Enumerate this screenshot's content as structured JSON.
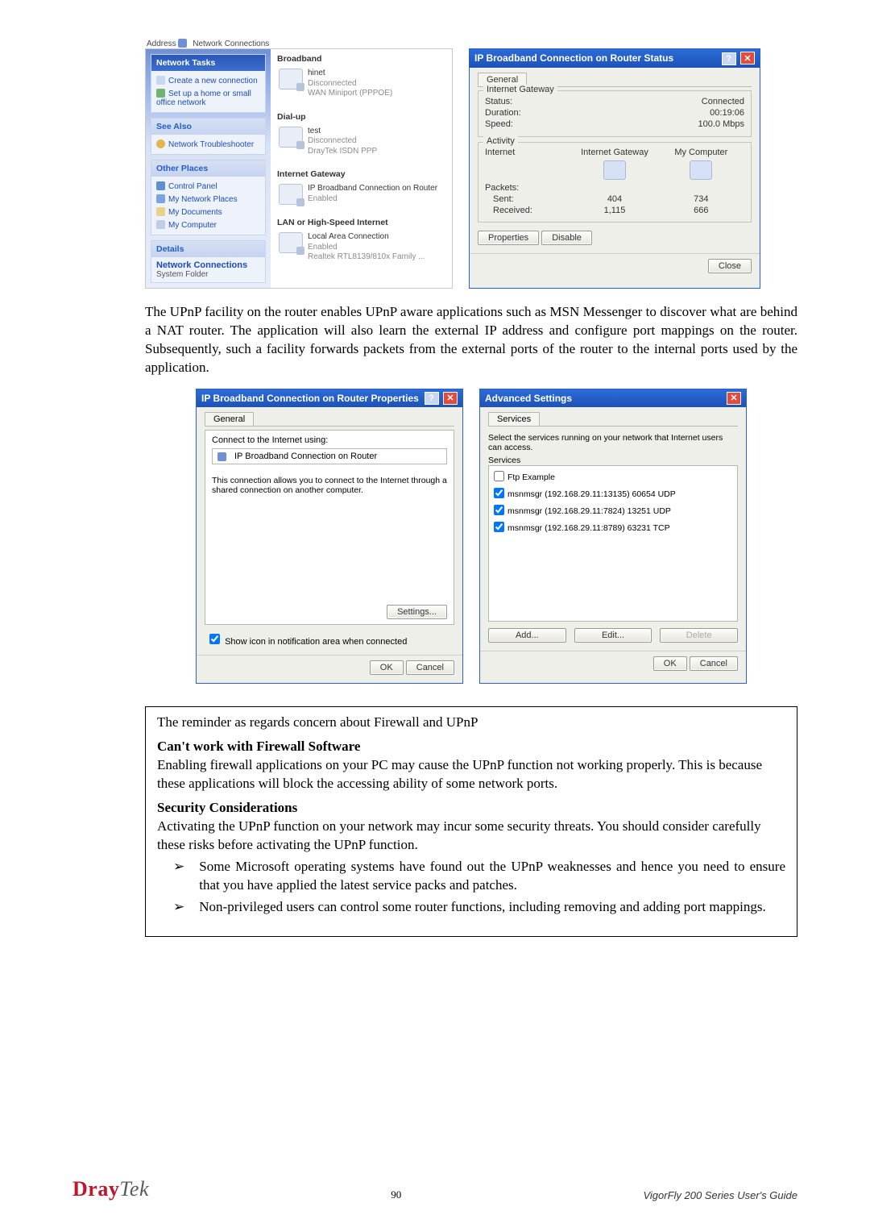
{
  "nc": {
    "addressLabel": "Address",
    "addressValue": "Network Connections",
    "side": {
      "tasksHead": "Network Tasks",
      "task1": "Create a new connection",
      "task2": "Set up a home or small office network",
      "seeAlsoHead": "See Also",
      "seeAlso1": "Network Troubleshooter",
      "otherHead": "Other Places",
      "other1": "Control Panel",
      "other2": "My Network Places",
      "other3": "My Documents",
      "other4": "My Computer",
      "detailsHead": "Details",
      "detailsTitle": "Network Connections",
      "detailsSub": "System Folder"
    },
    "groups": {
      "broadband": "Broadband",
      "bb1_name": "hinet",
      "bb1_state": "Disconnected",
      "bb1_dev": "WAN Miniport (PPPOE)",
      "dialup": "Dial-up",
      "du1_name": "test",
      "du1_state": "Disconnected",
      "du1_dev": "DrayTek ISDN PPP",
      "igw": "Internet Gateway",
      "igw_name": "IP Broadband Connection on Router",
      "igw_state": "Enabled",
      "lan": "LAN or High-Speed Internet",
      "lan_name": "Local Area Connection",
      "lan_state": "Enabled",
      "lan_dev": "Realtek RTL8139/810x Family ..."
    }
  },
  "status": {
    "title": "IP Broadband Connection on Router Status",
    "tabGeneral": "General",
    "grpIG": "Internet Gateway",
    "statusLabel": "Status:",
    "statusVal": "Connected",
    "durLabel": "Duration:",
    "durVal": "00:19:06",
    "speedLabel": "Speed:",
    "speedVal": "100.0 Mbps",
    "grpAct": "Activity",
    "colInternet": "Internet",
    "colIG": "Internet Gateway",
    "colMy": "My Computer",
    "packetsLabel": "Packets:",
    "sentLabel": "Sent:",
    "recvLabel": "Received:",
    "sentIG": "404",
    "recvIG": "1,115",
    "sentMy": "734",
    "recvMy": "666",
    "btnProps": "Properties",
    "btnDisable": "Disable",
    "btnClose": "Close"
  },
  "para1": "The UPnP facility on the router enables UPnP aware applications such as MSN Messenger to discover what are behind a NAT router. The application will also learn the external IP address and configure port mappings on the router. Subsequently, such a facility forwards packets from the external ports of the router to the internal ports used by the application.",
  "props": {
    "title": "IP Broadband Connection on Router Properties",
    "tabGeneral": "General",
    "connUsing": "Connect to the Internet using:",
    "connName": "IP Broadband Connection on Router",
    "desc": "This connection allows you to connect to the Internet through a shared connection on another computer.",
    "settingsBtn": "Settings...",
    "notifChk": "Show icon in notification area when connected",
    "ok": "OK",
    "cancel": "Cancel"
  },
  "adv": {
    "title": "Advanced Settings",
    "tabServices": "Services",
    "blurb": "Select the services running on your network that Internet users can access.",
    "listHead": "Services",
    "s1": "Ftp Example",
    "s2": "msnmsgr (192.168.29.11:13135) 60654 UDP",
    "s3": "msnmsgr (192.168.29.11:7824) 13251 UDP",
    "s4": "msnmsgr (192.168.29.11:8789) 63231 TCP",
    "add": "Add...",
    "edit": "Edit...",
    "del": "Delete",
    "ok": "OK",
    "cancel": "Cancel"
  },
  "reminder": {
    "intro": "The reminder as regards concern about Firewall and UPnP",
    "h1": "Can't work with Firewall Software",
    "p1": "Enabling firewall applications on your PC may cause the UPnP function not working properly. This is because these applications will block the accessing ability of some network ports.",
    "h2": "Security Considerations",
    "p2": "Activating the UPnP function on your network may incur some security threats. You should consider carefully these risks before activating the UPnP function.",
    "b1": "Some Microsoft operating systems have found out the UPnP weaknesses and hence you need to ensure that you have applied the latest service packs and patches.",
    "b2": "Non-privileged users can control some router functions, including removing and adding port mappings."
  },
  "footer": {
    "brandA": "Dray",
    "brandB": "Tek",
    "page": "90",
    "guide": "VigorFly 200 Series User's Guide"
  }
}
